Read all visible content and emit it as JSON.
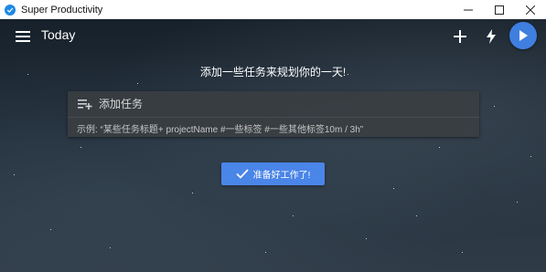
{
  "window": {
    "title": "Super Productivity",
    "controls": [
      "minimize-icon",
      "maximize-icon",
      "close-icon"
    ]
  },
  "toolbar": {
    "menu_icon": "menu-icon",
    "page_title": "Today",
    "add_icon": "plus-icon",
    "focus_icon": "lightning-icon",
    "play_icon": "play-icon"
  },
  "main": {
    "heading": "添加一些任务来规划你的一天!",
    "add_task": {
      "icon": "playlist-add-icon",
      "placeholder": "添加任务",
      "value": "",
      "hint": "示例: “某些任务标题+ projectName #一些标签 #一些其他标签10m / 3h”"
    },
    "ready_button": {
      "icon": "check-icon",
      "label": "准备好工作了!"
    }
  },
  "colors": {
    "accent": "#4a85e8",
    "play_button": "#3f7fe0",
    "titlebar_bg": "#ffffff",
    "input_bg": "#3a3e42"
  }
}
